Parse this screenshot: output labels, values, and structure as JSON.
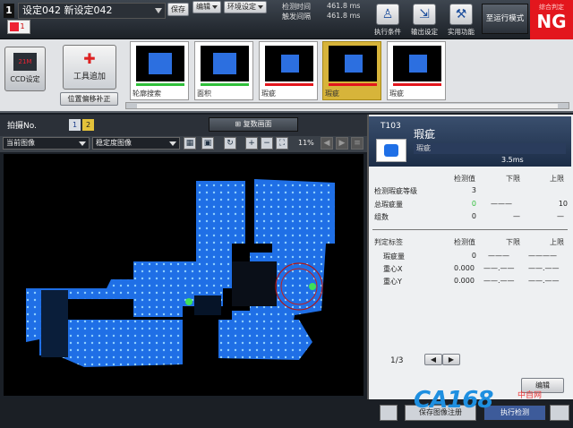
{
  "header": {
    "set_number": "1",
    "title": "设定042 新设定042",
    "save_label": "保存",
    "edit_label": "编辑",
    "env_label": "环境设定",
    "detect_time_label": "检测时间",
    "detect_time_value": "461.8 ms",
    "trigger_interval_label": "触发间隔",
    "trigger_interval_value": "461.8 ms",
    "tab_label": "1"
  },
  "toolbar_right": {
    "exec_cond": "执行条件",
    "output_set": "输出设定",
    "utility": "实用功能",
    "run_mode": "至运行模式",
    "overall_label": "综合判定",
    "overall_result": "NG"
  },
  "tools": {
    "ccd_label": "CCD设定",
    "ccd_badge": "21M",
    "add_tool": "工具追加",
    "pos_correct": "位置偏移补正",
    "thumbnails": [
      {
        "label": "轮廓搜索",
        "color": "#2fbf3a"
      },
      {
        "label": "面积",
        "color": "#2fbf3a"
      },
      {
        "label": "瑕疵",
        "color": "#e3161d"
      },
      {
        "label": "瑕疵",
        "color": "#e3161d"
      },
      {
        "label": "瑕疵",
        "color": "#e3161d"
      }
    ]
  },
  "image_panel": {
    "shot_label": "拍摄No.",
    "shot1": "1",
    "shot2": "2",
    "multi_screen": "复数画面",
    "image_select": "当前图像",
    "stability_select": "稳定度图像",
    "zoom": "11%"
  },
  "result_panel": {
    "tool_id": "T103",
    "tool_name": "瑕疵",
    "tool_sub": "瑕疵",
    "proc_time": "3.5ms",
    "col_detect": "检测值",
    "col_lower": "下限",
    "col_upper": "上限",
    "rows1": [
      {
        "label": "检测瑕疵等级",
        "value": "3",
        "lower": "",
        "upper": ""
      },
      {
        "label": "总瑕疵量",
        "value": "0",
        "lower": "———",
        "upper": "10"
      },
      {
        "label": "组数",
        "value": "0",
        "lower": "—",
        "upper": "—"
      }
    ],
    "section2": "判定标签",
    "rows2": [
      {
        "label": "瑕疵量",
        "value": "0",
        "lower": "———",
        "upper": "————"
      },
      {
        "label": "重心X",
        "value": "0.000",
        "lower": "——.——",
        "upper": "——.——"
      },
      {
        "label": "重心Y",
        "value": "0.000",
        "lower": "——.——",
        "upper": "——.——"
      }
    ],
    "page": "1/3",
    "prev": "◀",
    "next": "▶",
    "edit": "编辑"
  },
  "bottom": {
    "save_image": "保存图像注册",
    "exec_test": "执行检测",
    "watermark": "CA168",
    "watermark_sub": "中自网"
  }
}
